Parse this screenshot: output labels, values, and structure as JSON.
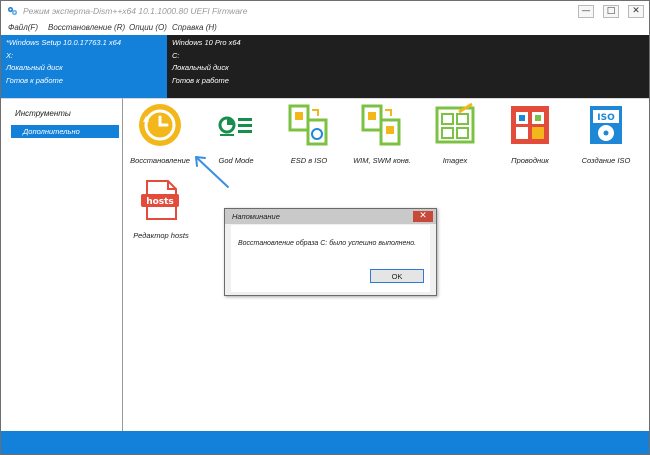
{
  "window": {
    "title": "Режим эксперта-Dism++x64 10.1.1000.80 UEFI Firmware",
    "minimize_glyph": "—",
    "maximize_glyph": "□",
    "close_glyph": "✕"
  },
  "menu": {
    "items": [
      "Файл(F)",
      "Восстановление (R)",
      "Опции (O)",
      "Справка (H)"
    ]
  },
  "images": [
    {
      "lines": [
        "*Windows Setup 10.0.17763.1 x64",
        "X:",
        "Локальный диск",
        "Готов к работе"
      ],
      "selected": true
    },
    {
      "lines": [
        "Windows 10 Pro x64",
        "C:",
        "Локальный диск",
        "Готов к работе"
      ],
      "selected": false
    }
  ],
  "sidebar": {
    "header": "Инструменты",
    "selected_item": "Дополнительно"
  },
  "tools": [
    {
      "label": "Восстановление",
      "icon": "restore-clock-icon"
    },
    {
      "label": "God Mode",
      "icon": "god-mode-icon"
    },
    {
      "label": "ESD в ISO",
      "icon": "esd-to-iso-icon"
    },
    {
      "label": "WIM, SWM конв.",
      "icon": "wim-swm-icon"
    },
    {
      "label": "Imagex",
      "icon": "imagex-icon"
    },
    {
      "label": "Проводник",
      "icon": "explorer-icon"
    },
    {
      "label": "Создание ISO",
      "icon": "create-iso-icon"
    },
    {
      "label": "Редактор hosts",
      "icon": "hosts-file-icon"
    }
  ],
  "hosts_icon_text": "hosts",
  "iso_icon_text": "ISO",
  "dialog": {
    "title": "Напоминание",
    "message": "Восстановление образа C: было успешно выполнено.",
    "ok_label": "OK",
    "close_glyph": "✕"
  },
  "colors": {
    "accent": "#1380d9",
    "dark_panel": "#1f1f1f",
    "icon_green": "#7cc242",
    "icon_yellow": "#f3b71b"
  }
}
